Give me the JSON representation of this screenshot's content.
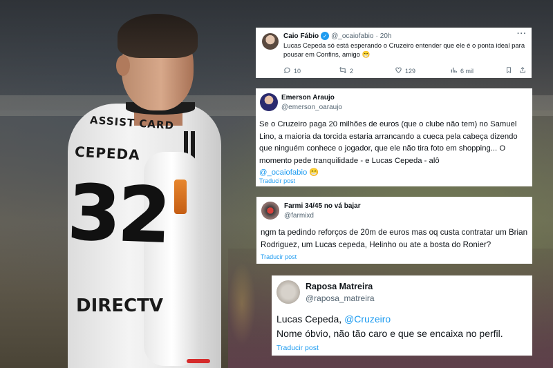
{
  "colors": {
    "link": "#1d9bf0",
    "muted": "#536471",
    "text": "#0f1419",
    "card_bg": "#ffffff"
  },
  "background": {
    "jersey_sponsor_top": "ASSIST CARD",
    "jersey_name": "CEPEDA",
    "jersey_number": "32",
    "jersey_sponsor_bottom": "DIRECTV"
  },
  "tweets": [
    {
      "name": "Caio Fábio",
      "verified": true,
      "handle": "@_ocaiofabio",
      "separator": "·",
      "time": "20h",
      "more": "···",
      "text": "Lucas Cepeda só está esperando o Cruzeiro entender que ele é o ponta ideal para pousar em Confins, amigo 😁",
      "actions": {
        "replies": "10",
        "retweets": "2",
        "likes": "129",
        "views": "6 mil",
        "reply_icon": "reply-icon",
        "retweet_icon": "retweet-icon",
        "like_icon": "heart-icon",
        "views_icon": "views-icon",
        "bookmark_icon": "bookmark-icon",
        "share_icon": "share-icon"
      }
    },
    {
      "name": "Emerson Araujo",
      "handle": "@emerson_oaraujo",
      "text": "Se o Cruzeiro paga 20 milhões de euros (que o clube não tem) no Samuel Lino, a maioria da torcida estaria arrancando a cueca pela cabeça dizendo que ninguém conhece o jogador, que ele não tira foto em shopping... O momento pede tranquilidade - e Lucas Cepeda - alô",
      "mention": "@_ocaiofabio",
      "emoji": "😁",
      "translate": "Traducir post"
    },
    {
      "name": "Farmi 34/45 no vá bajar",
      "handle": "@farmixd",
      "text": "ngm ta pedindo reforços de 20m de euros mas oq custa contratar um Brian Rodriguez, um Lucas cepeda, Helinho ou ate a bosta do Ronier?",
      "translate": "Traducir post"
    },
    {
      "name": "Raposa Matreira",
      "handle": "@raposa_matreira",
      "text_before": "Lucas Cepeda, ",
      "mention": "@Cruzeiro",
      "text_after": "Nome óbvio, não tão caro e que se encaixa no perfil.",
      "translate": "Traducir post"
    }
  ]
}
